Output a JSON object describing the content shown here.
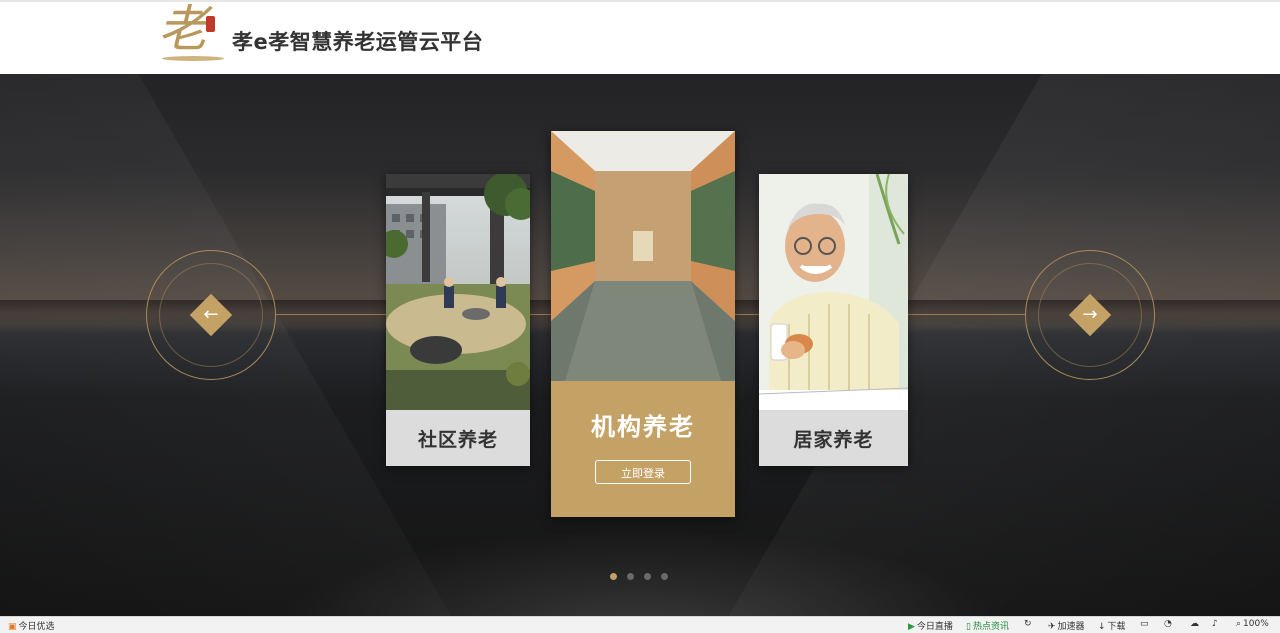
{
  "header": {
    "brand_title": "孝e孝智慧养老运管云平台",
    "logo_icon": "calligraphy-lao-logo"
  },
  "carousel": {
    "prev_icon": "←",
    "next_icon": "→",
    "cards": [
      {
        "label": "社区养老",
        "photo": "community-garden"
      },
      {
        "label": "机构养老",
        "photo": "institution-corridor",
        "button": "立即登录"
      },
      {
        "label": "居家养老",
        "photo": "elderly-man-home"
      }
    ],
    "dots": 4,
    "active_dot": 0
  },
  "statusbar": {
    "left_label": "今日优选",
    "items": [
      "今日直播",
      "热点资讯",
      "加速器",
      "下载",
      "100%"
    ]
  },
  "colors": {
    "gold": "#c4a265",
    "dark": "#1c1d1f",
    "caption_gray": "#dcdcdc"
  }
}
